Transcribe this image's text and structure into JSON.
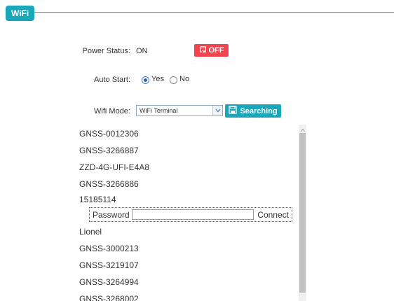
{
  "header": {
    "tab_label": "WiFi"
  },
  "power": {
    "label": "Power Status:",
    "value": "ON",
    "toggle_label": "OFF"
  },
  "auto_start": {
    "label": "Auto Start:",
    "yes_label": "Yes",
    "no_label": "No",
    "selected": "Yes"
  },
  "wifi_mode": {
    "label": "Wifi Mode:",
    "selected": "WiFi Terminal",
    "search_label": "Searching"
  },
  "networks": [
    "GNSS-0012306",
    "GNSS-3266887",
    "ZZD-4G-UFI-E4A8",
    "GNSS-3266886",
    "15185114",
    "Lionel",
    "GNSS-3000213",
    "GNSS-3219107",
    "GNSS-3264994",
    "GNSS-3268002"
  ],
  "password_prompt": {
    "label": "Password",
    "value": "",
    "connect_label": "Connect"
  },
  "colors": {
    "accent": "#19a7ba",
    "off_button": "#f2444f"
  }
}
